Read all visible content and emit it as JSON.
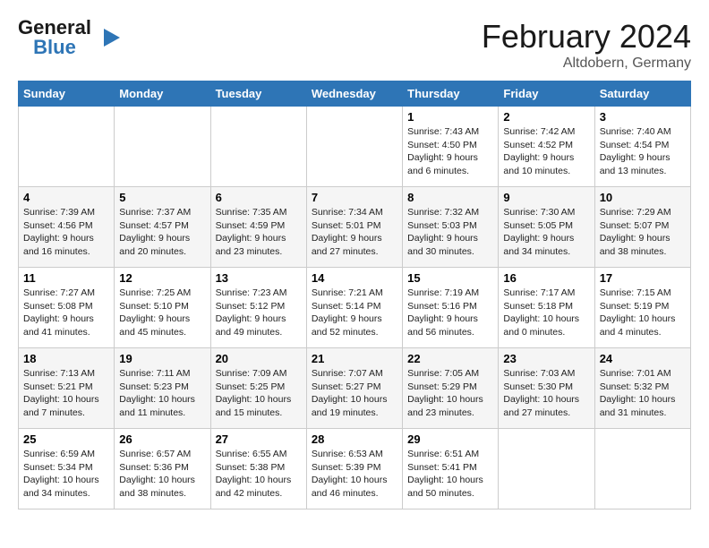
{
  "header": {
    "logo_line1": "General",
    "logo_line2": "Blue",
    "main_title": "February 2024",
    "subtitle": "Altdobern, Germany"
  },
  "weekdays": [
    "Sunday",
    "Monday",
    "Tuesday",
    "Wednesday",
    "Thursday",
    "Friday",
    "Saturday"
  ],
  "weeks": [
    [
      {
        "day": "",
        "sunrise": "",
        "sunset": "",
        "daylight": ""
      },
      {
        "day": "",
        "sunrise": "",
        "sunset": "",
        "daylight": ""
      },
      {
        "day": "",
        "sunrise": "",
        "sunset": "",
        "daylight": ""
      },
      {
        "day": "",
        "sunrise": "",
        "sunset": "",
        "daylight": ""
      },
      {
        "day": "1",
        "sunrise": "7:43 AM",
        "sunset": "4:50 PM",
        "daylight": "9 hours and 6 minutes."
      },
      {
        "day": "2",
        "sunrise": "7:42 AM",
        "sunset": "4:52 PM",
        "daylight": "9 hours and 10 minutes."
      },
      {
        "day": "3",
        "sunrise": "7:40 AM",
        "sunset": "4:54 PM",
        "daylight": "9 hours and 13 minutes."
      }
    ],
    [
      {
        "day": "4",
        "sunrise": "7:39 AM",
        "sunset": "4:56 PM",
        "daylight": "9 hours and 16 minutes."
      },
      {
        "day": "5",
        "sunrise": "7:37 AM",
        "sunset": "4:57 PM",
        "daylight": "9 hours and 20 minutes."
      },
      {
        "day": "6",
        "sunrise": "7:35 AM",
        "sunset": "4:59 PM",
        "daylight": "9 hours and 23 minutes."
      },
      {
        "day": "7",
        "sunrise": "7:34 AM",
        "sunset": "5:01 PM",
        "daylight": "9 hours and 27 minutes."
      },
      {
        "day": "8",
        "sunrise": "7:32 AM",
        "sunset": "5:03 PM",
        "daylight": "9 hours and 30 minutes."
      },
      {
        "day": "9",
        "sunrise": "7:30 AM",
        "sunset": "5:05 PM",
        "daylight": "9 hours and 34 minutes."
      },
      {
        "day": "10",
        "sunrise": "7:29 AM",
        "sunset": "5:07 PM",
        "daylight": "9 hours and 38 minutes."
      }
    ],
    [
      {
        "day": "11",
        "sunrise": "7:27 AM",
        "sunset": "5:08 PM",
        "daylight": "9 hours and 41 minutes."
      },
      {
        "day": "12",
        "sunrise": "7:25 AM",
        "sunset": "5:10 PM",
        "daylight": "9 hours and 45 minutes."
      },
      {
        "day": "13",
        "sunrise": "7:23 AM",
        "sunset": "5:12 PM",
        "daylight": "9 hours and 49 minutes."
      },
      {
        "day": "14",
        "sunrise": "7:21 AM",
        "sunset": "5:14 PM",
        "daylight": "9 hours and 52 minutes."
      },
      {
        "day": "15",
        "sunrise": "7:19 AM",
        "sunset": "5:16 PM",
        "daylight": "9 hours and 56 minutes."
      },
      {
        "day": "16",
        "sunrise": "7:17 AM",
        "sunset": "5:18 PM",
        "daylight": "10 hours and 0 minutes."
      },
      {
        "day": "17",
        "sunrise": "7:15 AM",
        "sunset": "5:19 PM",
        "daylight": "10 hours and 4 minutes."
      }
    ],
    [
      {
        "day": "18",
        "sunrise": "7:13 AM",
        "sunset": "5:21 PM",
        "daylight": "10 hours and 7 minutes."
      },
      {
        "day": "19",
        "sunrise": "7:11 AM",
        "sunset": "5:23 PM",
        "daylight": "10 hours and 11 minutes."
      },
      {
        "day": "20",
        "sunrise": "7:09 AM",
        "sunset": "5:25 PM",
        "daylight": "10 hours and 15 minutes."
      },
      {
        "day": "21",
        "sunrise": "7:07 AM",
        "sunset": "5:27 PM",
        "daylight": "10 hours and 19 minutes."
      },
      {
        "day": "22",
        "sunrise": "7:05 AM",
        "sunset": "5:29 PM",
        "daylight": "10 hours and 23 minutes."
      },
      {
        "day": "23",
        "sunrise": "7:03 AM",
        "sunset": "5:30 PM",
        "daylight": "10 hours and 27 minutes."
      },
      {
        "day": "24",
        "sunrise": "7:01 AM",
        "sunset": "5:32 PM",
        "daylight": "10 hours and 31 minutes."
      }
    ],
    [
      {
        "day": "25",
        "sunrise": "6:59 AM",
        "sunset": "5:34 PM",
        "daylight": "10 hours and 34 minutes."
      },
      {
        "day": "26",
        "sunrise": "6:57 AM",
        "sunset": "5:36 PM",
        "daylight": "10 hours and 38 minutes."
      },
      {
        "day": "27",
        "sunrise": "6:55 AM",
        "sunset": "5:38 PM",
        "daylight": "10 hours and 42 minutes."
      },
      {
        "day": "28",
        "sunrise": "6:53 AM",
        "sunset": "5:39 PM",
        "daylight": "10 hours and 46 minutes."
      },
      {
        "day": "29",
        "sunrise": "6:51 AM",
        "sunset": "5:41 PM",
        "daylight": "10 hours and 50 minutes."
      },
      {
        "day": "",
        "sunrise": "",
        "sunset": "",
        "daylight": ""
      },
      {
        "day": "",
        "sunrise": "",
        "sunset": "",
        "daylight": ""
      }
    ]
  ]
}
